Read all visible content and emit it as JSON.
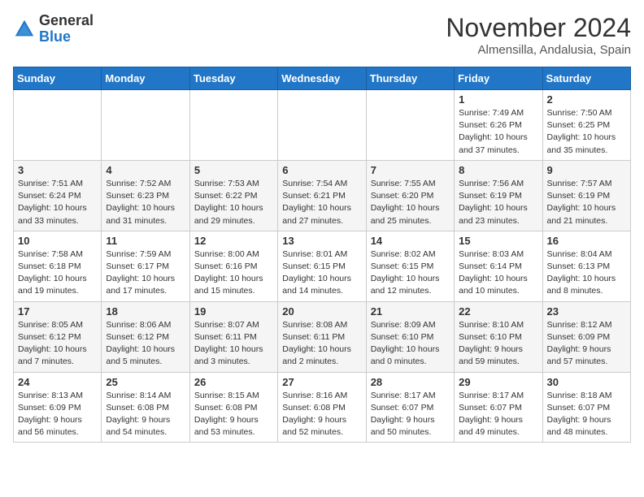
{
  "header": {
    "logo_general": "General",
    "logo_blue": "Blue",
    "month_title": "November 2024",
    "location": "Almensilla, Andalusia, Spain"
  },
  "weekdays": [
    "Sunday",
    "Monday",
    "Tuesday",
    "Wednesday",
    "Thursday",
    "Friday",
    "Saturday"
  ],
  "weeks": [
    [
      {
        "day": "",
        "info": ""
      },
      {
        "day": "",
        "info": ""
      },
      {
        "day": "",
        "info": ""
      },
      {
        "day": "",
        "info": ""
      },
      {
        "day": "",
        "info": ""
      },
      {
        "day": "1",
        "info": "Sunrise: 7:49 AM\nSunset: 6:26 PM\nDaylight: 10 hours\nand 37 minutes."
      },
      {
        "day": "2",
        "info": "Sunrise: 7:50 AM\nSunset: 6:25 PM\nDaylight: 10 hours\nand 35 minutes."
      }
    ],
    [
      {
        "day": "3",
        "info": "Sunrise: 7:51 AM\nSunset: 6:24 PM\nDaylight: 10 hours\nand 33 minutes."
      },
      {
        "day": "4",
        "info": "Sunrise: 7:52 AM\nSunset: 6:23 PM\nDaylight: 10 hours\nand 31 minutes."
      },
      {
        "day": "5",
        "info": "Sunrise: 7:53 AM\nSunset: 6:22 PM\nDaylight: 10 hours\nand 29 minutes."
      },
      {
        "day": "6",
        "info": "Sunrise: 7:54 AM\nSunset: 6:21 PM\nDaylight: 10 hours\nand 27 minutes."
      },
      {
        "day": "7",
        "info": "Sunrise: 7:55 AM\nSunset: 6:20 PM\nDaylight: 10 hours\nand 25 minutes."
      },
      {
        "day": "8",
        "info": "Sunrise: 7:56 AM\nSunset: 6:19 PM\nDaylight: 10 hours\nand 23 minutes."
      },
      {
        "day": "9",
        "info": "Sunrise: 7:57 AM\nSunset: 6:19 PM\nDaylight: 10 hours\nand 21 minutes."
      }
    ],
    [
      {
        "day": "10",
        "info": "Sunrise: 7:58 AM\nSunset: 6:18 PM\nDaylight: 10 hours\nand 19 minutes."
      },
      {
        "day": "11",
        "info": "Sunrise: 7:59 AM\nSunset: 6:17 PM\nDaylight: 10 hours\nand 17 minutes."
      },
      {
        "day": "12",
        "info": "Sunrise: 8:00 AM\nSunset: 6:16 PM\nDaylight: 10 hours\nand 15 minutes."
      },
      {
        "day": "13",
        "info": "Sunrise: 8:01 AM\nSunset: 6:15 PM\nDaylight: 10 hours\nand 14 minutes."
      },
      {
        "day": "14",
        "info": "Sunrise: 8:02 AM\nSunset: 6:15 PM\nDaylight: 10 hours\nand 12 minutes."
      },
      {
        "day": "15",
        "info": "Sunrise: 8:03 AM\nSunset: 6:14 PM\nDaylight: 10 hours\nand 10 minutes."
      },
      {
        "day": "16",
        "info": "Sunrise: 8:04 AM\nSunset: 6:13 PM\nDaylight: 10 hours\nand 8 minutes."
      }
    ],
    [
      {
        "day": "17",
        "info": "Sunrise: 8:05 AM\nSunset: 6:12 PM\nDaylight: 10 hours\nand 7 minutes."
      },
      {
        "day": "18",
        "info": "Sunrise: 8:06 AM\nSunset: 6:12 PM\nDaylight: 10 hours\nand 5 minutes."
      },
      {
        "day": "19",
        "info": "Sunrise: 8:07 AM\nSunset: 6:11 PM\nDaylight: 10 hours\nand 3 minutes."
      },
      {
        "day": "20",
        "info": "Sunrise: 8:08 AM\nSunset: 6:11 PM\nDaylight: 10 hours\nand 2 minutes."
      },
      {
        "day": "21",
        "info": "Sunrise: 8:09 AM\nSunset: 6:10 PM\nDaylight: 10 hours\nand 0 minutes."
      },
      {
        "day": "22",
        "info": "Sunrise: 8:10 AM\nSunset: 6:10 PM\nDaylight: 9 hours\nand 59 minutes."
      },
      {
        "day": "23",
        "info": "Sunrise: 8:12 AM\nSunset: 6:09 PM\nDaylight: 9 hours\nand 57 minutes."
      }
    ],
    [
      {
        "day": "24",
        "info": "Sunrise: 8:13 AM\nSunset: 6:09 PM\nDaylight: 9 hours\nand 56 minutes."
      },
      {
        "day": "25",
        "info": "Sunrise: 8:14 AM\nSunset: 6:08 PM\nDaylight: 9 hours\nand 54 minutes."
      },
      {
        "day": "26",
        "info": "Sunrise: 8:15 AM\nSunset: 6:08 PM\nDaylight: 9 hours\nand 53 minutes."
      },
      {
        "day": "27",
        "info": "Sunrise: 8:16 AM\nSunset: 6:08 PM\nDaylight: 9 hours\nand 52 minutes."
      },
      {
        "day": "28",
        "info": "Sunrise: 8:17 AM\nSunset: 6:07 PM\nDaylight: 9 hours\nand 50 minutes."
      },
      {
        "day": "29",
        "info": "Sunrise: 8:17 AM\nSunset: 6:07 PM\nDaylight: 9 hours\nand 49 minutes."
      },
      {
        "day": "30",
        "info": "Sunrise: 8:18 AM\nSunset: 6:07 PM\nDaylight: 9 hours\nand 48 minutes."
      }
    ]
  ]
}
